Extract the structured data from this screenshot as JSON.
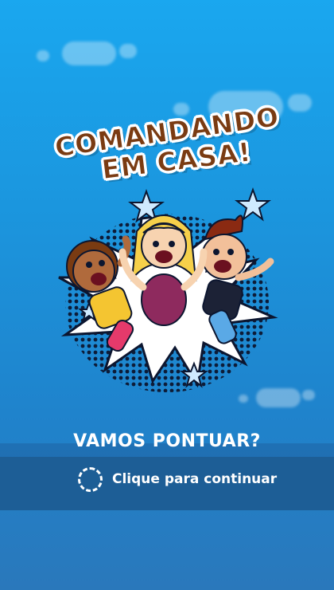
{
  "title": {
    "line1": "COMANDANDO",
    "line2": "EM CASA!"
  },
  "prompt": {
    "question": "VAMOS PONTUAR?",
    "continue_label": "Clique para continuar"
  },
  "colors": {
    "sky_top": "#1aa7ef",
    "sky_bottom": "#2a78bb",
    "title_brown": "#7a3b12",
    "band": "#1d5e96",
    "text_white": "#ffffff"
  },
  "illustration": {
    "subject": "three cheering kids on comic burst",
    "icons": [
      "star-icon",
      "star-icon",
      "star-icon",
      "star-icon"
    ]
  }
}
